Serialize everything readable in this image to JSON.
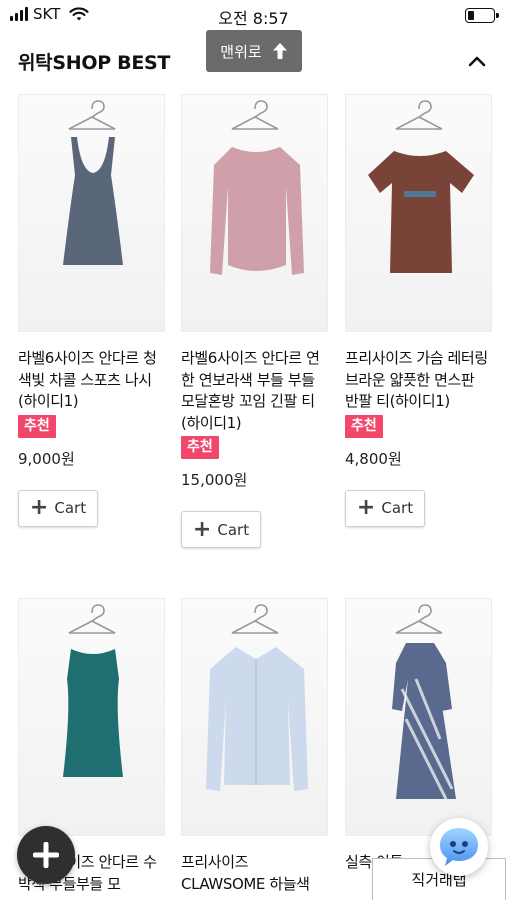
{
  "status_bar": {
    "carrier": "SKT",
    "time": "오전 8:57",
    "battery_level": 0.25
  },
  "header": {
    "title": "위탁SHOP BEST",
    "scroll_top_label": "맨위로"
  },
  "products": [
    {
      "name": "라벨6사이즈 안다르 청색빛 차콜 스포츠 나시(하이디1)",
      "badge": "추천",
      "price": "9,000원",
      "cart_label": "Cart",
      "garment": "tank",
      "color": "#5a6679"
    },
    {
      "name": "라벨6사이즈 안다르 연한 연보라색 부들 부들 모달혼방 꼬임 긴팔 티(하이디1)",
      "badge": "추천",
      "price": "15,000원",
      "cart_label": "Cart",
      "garment": "longsleeve",
      "color": "#cfa0aa"
    },
    {
      "name": "프리사이즈 가슴 레터링 브라운 얇픗한 면스판 반팔 티(하이디1)",
      "badge": "추천",
      "price": "4,800원",
      "cart_label": "Cart",
      "garment": "tee",
      "color": "#7a4338"
    },
    {
      "name": "라벨6사이즈 안다르 수박색 부들부들 모",
      "badge": "",
      "price": "",
      "cart_label": "",
      "garment": "sleeveless",
      "color": "#1f6f70"
    },
    {
      "name": "프리사이즈 CLAWSOME 하늘색",
      "badge": "",
      "price": "",
      "cart_label": "",
      "garment": "shirt",
      "color": "#cdd9ec"
    },
    {
      "name": "실측 이튼",
      "badge": "",
      "price": "",
      "cart_label": "",
      "garment": "dress",
      "color": "#5a6a8e"
    }
  ],
  "floating": {
    "direct_tab_label": "직거래탭",
    "add_icon": "plus-icon",
    "chat_icon": "chatbot-icon"
  },
  "colors": {
    "badge": "#f0476b",
    "top_button": "#6b6b6b"
  }
}
